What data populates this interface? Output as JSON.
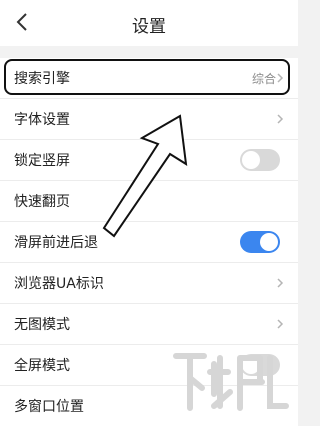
{
  "header": {
    "title": "设置"
  },
  "rows": [
    {
      "label": "搜索引擎",
      "value": "综合",
      "control": "chevron"
    },
    {
      "label": "字体设置",
      "control": "chevron"
    },
    {
      "label": "锁定竖屏",
      "control": "toggle",
      "toggle_on": false
    },
    {
      "label": "快速翻页",
      "control": "none"
    },
    {
      "label": "滑屏前进后退",
      "control": "toggle",
      "toggle_on": true
    },
    {
      "label": "浏览器UA标识",
      "control": "chevron"
    },
    {
      "label": "无图模式",
      "control": "chevron"
    },
    {
      "label": "全屏模式",
      "control": "toggle",
      "toggle_on": false
    },
    {
      "label": "多窗口位置",
      "control": "none"
    }
  ],
  "colors": {
    "accent": "#3b86ef",
    "toggle_off": "#d9d9d9",
    "background": "#f2f2f2"
  },
  "icons": [
    "back-icon",
    "chevron-right-icon",
    "pointer-arrow-annotation"
  ]
}
